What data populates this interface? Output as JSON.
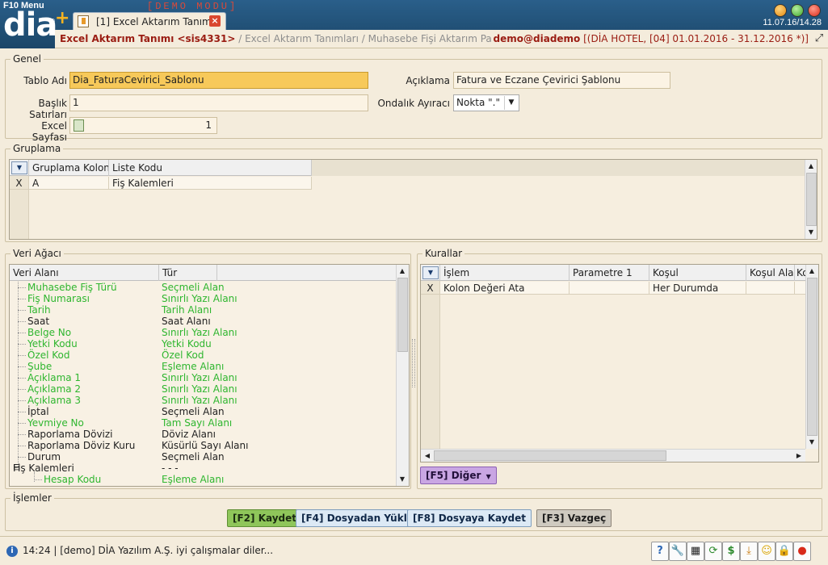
{
  "app": {
    "menu_label": "F10 Menu",
    "demo_label": "[DEMO MODU]",
    "logo": "dia",
    "registered": "®",
    "datetime": "11.07.16/14.28",
    "colors": {
      "accent": "#1b4668",
      "brand_red": "#9a1c12",
      "active_field": "#f7c95a"
    }
  },
  "tab": {
    "label": "[1] Excel Aktarım Tanımı"
  },
  "breadcrumb": {
    "active": "Excel Aktarım Tanımı <sis4331>",
    "rest": " / Excel Aktarım Tanımları / Muhasebe Fişi Aktarım Parametreleri / Gene",
    "user": "demo@diademo",
    "context": " [(DİA HOTEL, [04] 01.01.2016 - 31.12.2016 *)]"
  },
  "genel": {
    "title": "Genel",
    "tablo_adi_label": "Tablo Adı",
    "tablo_adi_value": "Dia_FaturaCevirici_Sablonu",
    "baslik_label": "Başlık Satırları",
    "baslik_value": "1",
    "excel_sayfasi_label": "Excel Sayfası",
    "excel_sayfasi_value": "1",
    "aciklama_label": "Açıklama",
    "aciklama_value": "Fatura ve Eczane Çevirici Şablonu",
    "ondalik_label": "Ondalık Ayıracı",
    "ondalik_value": "Nokta \".\""
  },
  "gruplama": {
    "title": "Gruplama",
    "columns": [
      "Gruplama Kolonu",
      "Liste Kodu"
    ],
    "rows": [
      {
        "mark": "X",
        "cells": [
          "A",
          "Fiş Kalemleri"
        ]
      }
    ]
  },
  "veri_agaci": {
    "title": "Veri Ağacı",
    "columns": [
      "Veri Alanı",
      "Tür"
    ],
    "rows": [
      {
        "name": "Muhasebe Fiş Türü",
        "type": "Seçmeli Alan",
        "green": true,
        "level": 1
      },
      {
        "name": "Fiş Numarası",
        "type": "Sınırlı Yazı Alanı",
        "green": true,
        "level": 1
      },
      {
        "name": "Tarih",
        "type": "Tarih Alanı",
        "green": true,
        "level": 1
      },
      {
        "name": "Saat",
        "type": "Saat Alanı",
        "green": false,
        "level": 1
      },
      {
        "name": "Belge No",
        "type": "Sınırlı Yazı Alanı",
        "green": true,
        "level": 1
      },
      {
        "name": "Yetki Kodu",
        "type": "Yetki Kodu",
        "green": true,
        "level": 1
      },
      {
        "name": "Özel Kod",
        "type": "Özel Kod",
        "green": true,
        "level": 1
      },
      {
        "name": "Şube",
        "type": "Eşleme Alanı",
        "green": true,
        "level": 1
      },
      {
        "name": "Açıklama 1",
        "type": "Sınırlı Yazı Alanı",
        "green": true,
        "level": 1
      },
      {
        "name": "Açıklama 2",
        "type": "Sınırlı Yazı Alanı",
        "green": true,
        "level": 1
      },
      {
        "name": "Açıklama 3",
        "type": "Sınırlı Yazı Alanı",
        "green": true,
        "level": 1
      },
      {
        "name": "İptal",
        "type": "Seçmeli Alan",
        "green": false,
        "level": 1
      },
      {
        "name": "Yevmiye No",
        "type": "Tam Sayı Alanı",
        "green": true,
        "level": 1
      },
      {
        "name": "Raporlama Dövizi",
        "type": "Döviz Alanı",
        "green": false,
        "level": 1
      },
      {
        "name": "Raporlama Döviz Kuru",
        "type": "Küsürlü Sayı Alanı",
        "green": false,
        "level": 1
      },
      {
        "name": "Durum",
        "type": "Seçmeli Alan",
        "green": false,
        "level": 1
      },
      {
        "name": "Fiş Kalemleri",
        "type": "- - -",
        "green": false,
        "level": 0,
        "expander": "⊟"
      },
      {
        "name": "Hesap Kodu",
        "type": "Eşleme Alanı",
        "green": true,
        "level": 2
      }
    ]
  },
  "kurallar": {
    "title": "Kurallar",
    "columns": [
      "İşlem",
      "Parametre 1",
      "Koşul",
      "Koşul Alan",
      "Ko"
    ],
    "rows": [
      {
        "mark": "X",
        "cells": [
          "Kolon Değeri Ata",
          "",
          "Her Durumda",
          "",
          ""
        ]
      }
    ],
    "other_button": "[F5] Diğer"
  },
  "islemler": {
    "title": "İşlemler",
    "save": "[F2] Kaydet",
    "load": "[F4] Dosyadan Yükle",
    "export": "[F8] Dosyaya Kaydet",
    "cancel": "[F3] Vazgeç"
  },
  "status": {
    "info_icon": "i",
    "text": "14:24 | [demo] DİA Yazılım A.Ş. iyi çalışmalar diler..."
  },
  "toolbar_icons": [
    {
      "name": "help-icon",
      "glyph": "?"
    },
    {
      "name": "tools-icon",
      "glyph": "🔧"
    },
    {
      "name": "calculator-icon",
      "glyph": "▦"
    },
    {
      "name": "refresh-icon",
      "glyph": "⟳"
    },
    {
      "name": "currency-icon",
      "glyph": "$"
    },
    {
      "name": "download-icon",
      "glyph": "⤓"
    },
    {
      "name": "smiley-icon",
      "glyph": "☺"
    },
    {
      "name": "lock-icon",
      "glyph": "🔒"
    },
    {
      "name": "stop-icon",
      "glyph": "●"
    }
  ]
}
